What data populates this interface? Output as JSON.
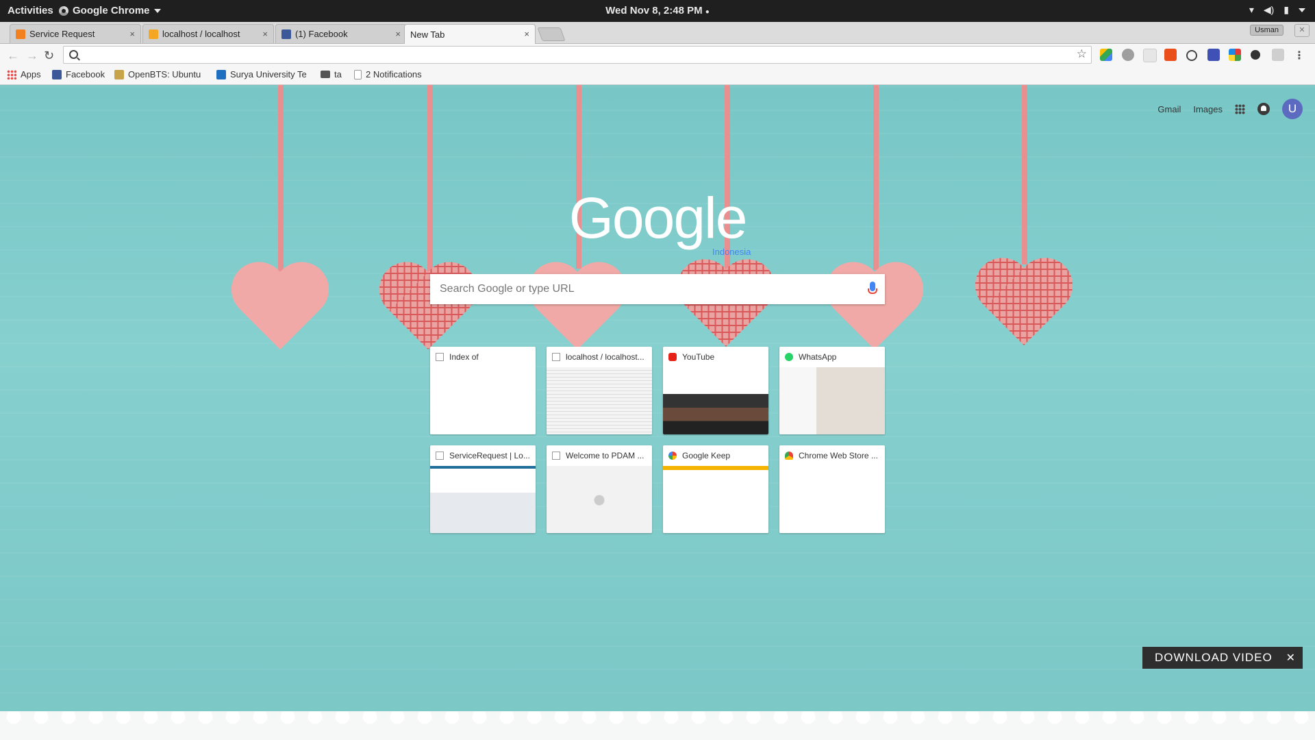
{
  "topbar": {
    "activities": "Activities",
    "app_name": "Google Chrome",
    "clock": "Wed Nov  8,  2:48 PM",
    "clock_dot": "●"
  },
  "tabs": [
    {
      "title": "Service Request",
      "favicon_color": "#f4811f",
      "active": false
    },
    {
      "title": "localhost / localhost",
      "favicon_color": "#f5a623",
      "active": false
    },
    {
      "title": "(1) Facebook",
      "favicon_color": "#3b5998",
      "active": false
    },
    {
      "title": "New Tab",
      "favicon_color": "",
      "active": true
    }
  ],
  "tab_close_glyph": "×",
  "profile_name": "Usman",
  "toolbar": {
    "omnibox_value": "",
    "extensions": [
      "google-drive-icon",
      "chat-icon",
      "extension-icon",
      "office-icon",
      "speed-icon",
      "download-icon",
      "color-picker-icon",
      "tool-icon",
      "keyboard-icon"
    ]
  },
  "bookmarks": [
    {
      "label": "Apps",
      "icon": "apps-grid-icon"
    },
    {
      "label": "Facebook",
      "icon": "facebook-icon"
    },
    {
      "label": "OpenBTS: Ubuntu",
      "icon": "openbts-icon"
    },
    {
      "label": "Surya University Te",
      "icon": "surya-icon"
    },
    {
      "label": "ta",
      "icon": "folder-icon"
    },
    {
      "label": "2 Notifications",
      "icon": "page-icon"
    }
  ],
  "ntp": {
    "gmail": "Gmail",
    "images": "Images",
    "avatar_letter": "U",
    "logo": "Google",
    "logo_sub": "Indonesia",
    "search_placeholder": "Search Google or type URL",
    "tiles": [
      {
        "title": "Index of",
        "icon": "page-icon"
      },
      {
        "title": "localhost / localhost...",
        "icon": "page-icon"
      },
      {
        "title": "YouTube",
        "icon": "youtube-icon"
      },
      {
        "title": "WhatsApp",
        "icon": "whatsapp-icon"
      },
      {
        "title": "ServiceRequest | Lo...",
        "icon": "page-icon"
      },
      {
        "title": "Welcome to PDAM ...",
        "icon": "page-icon"
      },
      {
        "title": "Google Keep",
        "icon": "google-icon"
      },
      {
        "title": "Chrome Web Store ...",
        "icon": "chrome-web-store-icon"
      }
    ]
  },
  "download_banner": {
    "label": "DOWNLOAD VIDEO",
    "close": "✕"
  },
  "colors": {
    "accent": "#4285f4",
    "background": "#7cc9c9",
    "heart": "#f0a9a6"
  }
}
